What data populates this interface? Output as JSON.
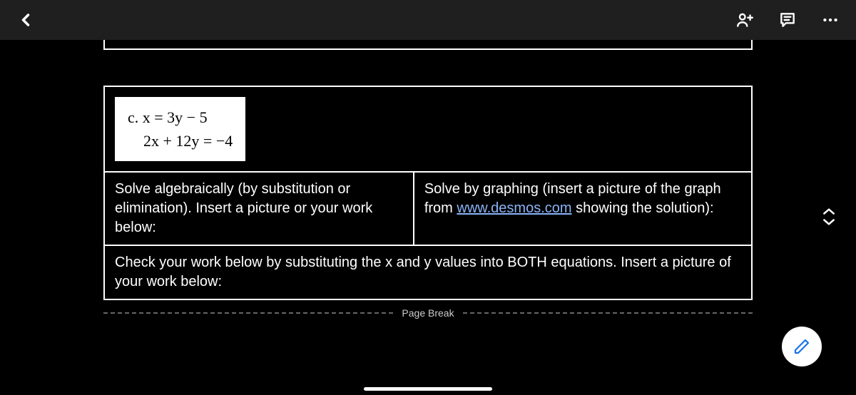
{
  "toolbar": {
    "back_label": "Back"
  },
  "problem": {
    "label": "c.",
    "eq1_text": "c. x = 3y − 5",
    "eq2_text": "2x + 12y = −4"
  },
  "cells": {
    "algebraic": "Solve algebraically (by substitution or elimination). Insert a picture or your work below:",
    "graph_pre": "Solve by graphing (insert a picture of the graph from ",
    "graph_link": "www.desmos.com",
    "graph_post": " showing the solution):",
    "check": "Check your work below by substituting the x and y values into BOTH equations. Insert a picture of your work below:"
  },
  "page_break_label": "Page Break"
}
